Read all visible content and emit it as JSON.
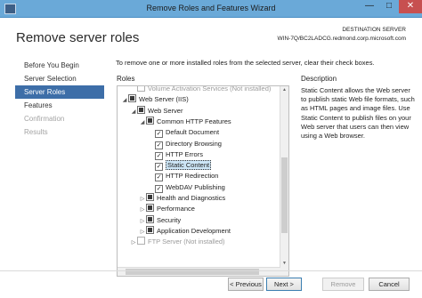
{
  "window": {
    "title": "Remove Roles and Features Wizard",
    "minimize": "—",
    "maximize": "□",
    "close": "✕"
  },
  "header": {
    "title": "Remove server roles",
    "destination_label": "DESTINATION SERVER",
    "destination_server": "WIN-7Q/BC2LADCG.redmond.corp.microsoft.com"
  },
  "steps": [
    {
      "label": "Before You Begin",
      "state": "normal"
    },
    {
      "label": "Server Selection",
      "state": "normal"
    },
    {
      "label": "Server Roles",
      "state": "active"
    },
    {
      "label": "Features",
      "state": "normal"
    },
    {
      "label": "Confirmation",
      "state": "disabled"
    },
    {
      "label": "Results",
      "state": "disabled"
    }
  ],
  "intro": "To remove one or more installed roles from the selected server, clear their check boxes.",
  "roles_header": "Roles",
  "description_header": "Description",
  "tree": [
    {
      "label": "Volume Activation Services (Not installed)",
      "expander": "",
      "check": "none",
      "disabled": true,
      "level": 1
    },
    {
      "label": "Web Server (IIS)",
      "expander": "◢",
      "check": "partial",
      "level": 0
    },
    {
      "label": "Web Server",
      "expander": "◢",
      "check": "partial",
      "level": 1
    },
    {
      "label": "Common HTTP Features",
      "expander": "◢",
      "check": "partial",
      "level": 2
    },
    {
      "label": "Default Document",
      "expander": "",
      "check": "checked",
      "level": 3
    },
    {
      "label": "Directory Browsing",
      "expander": "",
      "check": "checked",
      "level": 3
    },
    {
      "label": "HTTP Errors",
      "expander": "",
      "check": "checked",
      "level": 3
    },
    {
      "label": "Static Content",
      "expander": "",
      "check": "checked",
      "level": 3,
      "selected": true
    },
    {
      "label": "HTTP Redirection",
      "expander": "",
      "check": "checked",
      "level": 3
    },
    {
      "label": "WebDAV Publishing",
      "expander": "",
      "check": "checked",
      "level": 3
    },
    {
      "label": "Health and Diagnostics",
      "expander": "▷",
      "check": "partial",
      "level": 2
    },
    {
      "label": "Performance",
      "expander": "▷",
      "check": "partial",
      "level": 2
    },
    {
      "label": "Security",
      "expander": "▷",
      "check": "partial",
      "level": 2
    },
    {
      "label": "Application Development",
      "expander": "▷",
      "check": "partial",
      "level": 2
    },
    {
      "label": "FTP Server (Not installed)",
      "expander": "▷",
      "check": "none",
      "disabled": true,
      "level": 1
    }
  ],
  "description": "Static Content allows the Web server to publish static Web file formats, such as HTML pages and image files. Use Static Content to publish files on your Web server that users can then view using a Web browser.",
  "buttons": {
    "previous": "< Previous",
    "next": "Next >",
    "remove": "Remove",
    "cancel": "Cancel"
  },
  "colors": {
    "titlebar": "#6aa9d8",
    "active_step": "#3d6ea8",
    "selection": "#cde6f7",
    "close_button": "#c75050"
  }
}
